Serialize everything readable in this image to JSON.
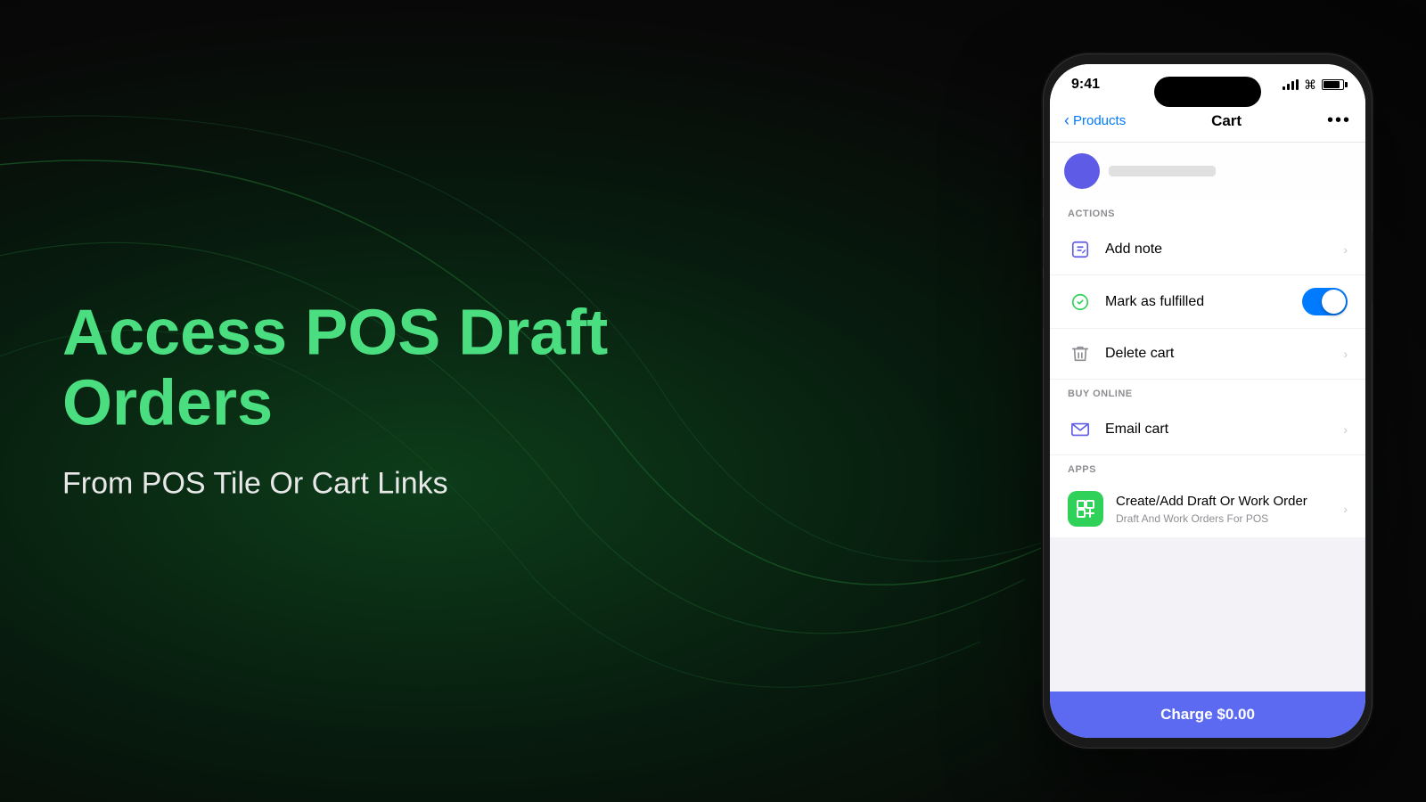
{
  "background": {
    "color_start": "#0d3d1a",
    "color_end": "#050505"
  },
  "left": {
    "main_title": "Access POS Draft Orders",
    "sub_title": "From POS Tile Or Cart Links"
  },
  "phone": {
    "status_bar": {
      "time": "9:41",
      "signal_label": "signal",
      "wifi_label": "wifi",
      "battery_label": "battery"
    },
    "nav": {
      "back_label": "Products",
      "title": "Cart",
      "more_label": "•••"
    },
    "menu": {
      "actions_section": "ACTIONS",
      "add_note_label": "Add note",
      "mark_fulfilled_label": "Mark as fulfilled",
      "toggle_on": true,
      "delete_cart_label": "Delete cart",
      "buy_online_section": "BUY ONLINE",
      "email_cart_label": "Email cart",
      "apps_section": "APPS",
      "app_title": "Create/Add Draft Or Work Order",
      "app_subtitle": "Draft And Work Orders For POS"
    },
    "charge_button": {
      "label": "Charge $0.00"
    }
  }
}
